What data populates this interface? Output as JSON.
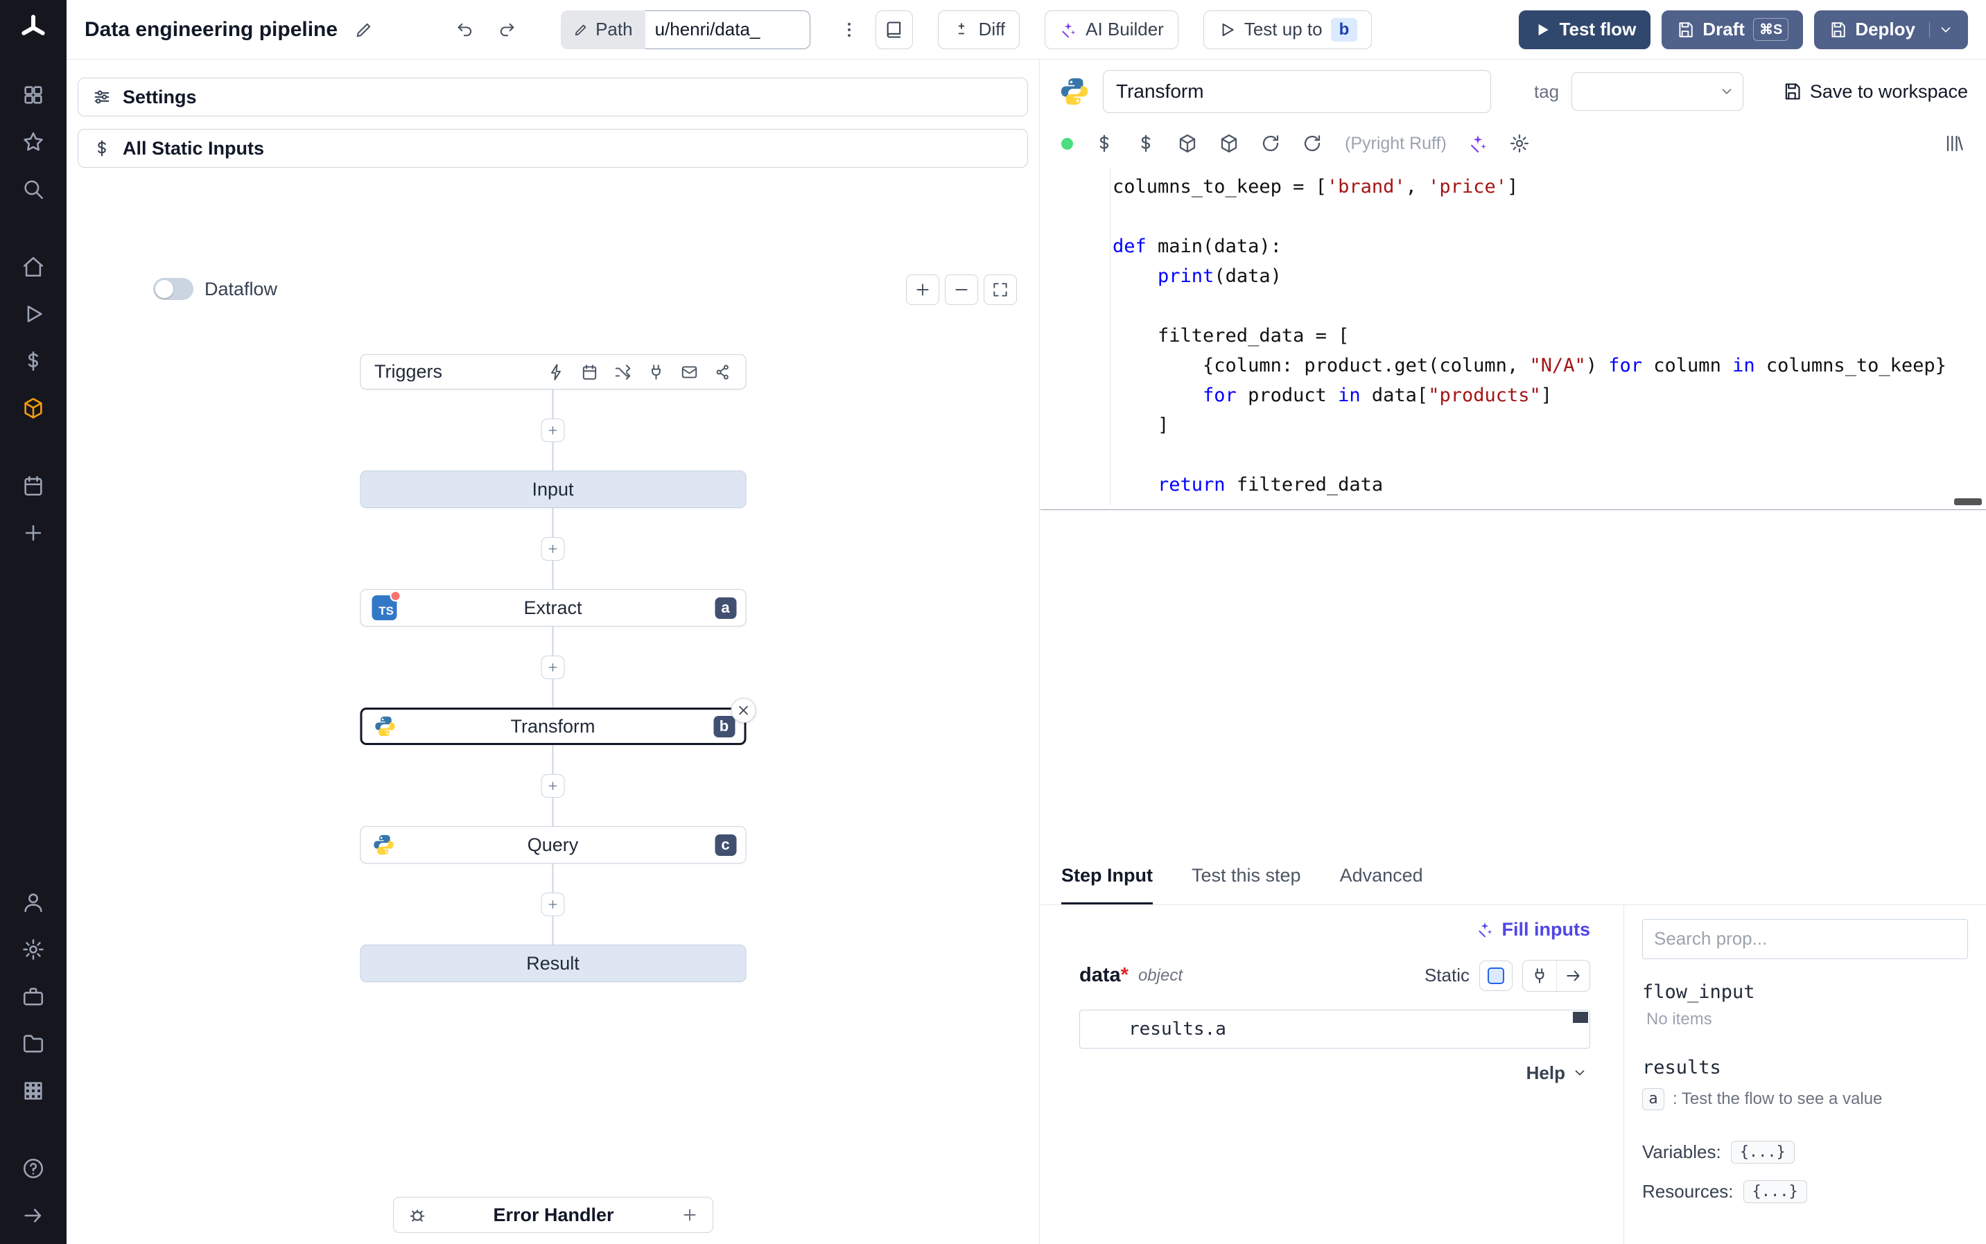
{
  "topbar": {
    "title": "Data engineering pipeline",
    "path_label": "Path",
    "path_value": "u/henri/data_",
    "diff_label": "Diff",
    "ai_builder_label": "AI Builder",
    "test_up_to_label": "Test up to",
    "test_up_to_badge": "b",
    "test_flow_label": "Test flow",
    "draft_label": "Draft",
    "draft_shortcut": "⌘S",
    "deploy_label": "Deploy"
  },
  "flow_panel": {
    "settings_label": "Settings",
    "static_inputs_label": "All Static Inputs",
    "dataflow_label": "Dataflow",
    "triggers_label": "Triggers",
    "nodes": {
      "input": "Input",
      "extract": {
        "label": "Extract",
        "badge": "a"
      },
      "transform": {
        "label": "Transform",
        "badge": "b"
      },
      "query": {
        "label": "Query",
        "badge": "c"
      },
      "result": "Result"
    },
    "error_handler_label": "Error Handler"
  },
  "editor": {
    "step_name": "Transform",
    "tag_label": "tag",
    "save_label": "Save to workspace",
    "lint_label": "(Pyright Ruff)"
  },
  "code": {
    "lines": [
      [
        [
          "columns_to_keep = [",
          ""
        ],
        [
          "'brand'",
          "s"
        ],
        [
          ", ",
          ""
        ],
        [
          "'price'",
          "s"
        ],
        [
          "]",
          ""
        ]
      ],
      [],
      [
        [
          "def",
          "k"
        ],
        [
          " main(data):",
          ""
        ]
      ],
      [
        [
          "    ",
          ""
        ],
        [
          "print",
          "k"
        ],
        [
          "(data)",
          ""
        ]
      ],
      [],
      [
        [
          "    filtered_data = [",
          ""
        ]
      ],
      [
        [
          "        {column: product.get(column, ",
          ""
        ],
        [
          "\"N/A\"",
          "s"
        ],
        [
          ") ",
          ""
        ],
        [
          "for",
          "k"
        ],
        [
          " column ",
          ""
        ],
        [
          "in",
          "k"
        ],
        [
          " columns_to_keep}",
          ""
        ]
      ],
      [
        [
          "        ",
          ""
        ],
        [
          "for",
          "k"
        ],
        [
          " product ",
          ""
        ],
        [
          "in",
          "k"
        ],
        [
          " data[",
          ""
        ],
        [
          "\"products\"",
          "s"
        ],
        [
          "]",
          ""
        ]
      ],
      [
        [
          "    ]",
          ""
        ]
      ],
      [],
      [
        [
          "    ",
          ""
        ],
        [
          "return",
          "k"
        ],
        [
          " filtered_data",
          ""
        ]
      ]
    ]
  },
  "step_panel": {
    "tabs": [
      "Step Input",
      "Test this step",
      "Advanced"
    ],
    "fill_inputs_label": "Fill inputs",
    "arg_name": "data",
    "arg_required": "*",
    "arg_type": "object",
    "static_label": "Static",
    "arg_value": "results.a",
    "help_label": "Help"
  },
  "props_panel": {
    "search_placeholder": "Search prop...",
    "flow_input_label": "flow_input",
    "flow_input_empty": "No items",
    "results_label": "results",
    "result_key": "a",
    "result_hint": ": Test the flow to see a value",
    "variables_label": "Variables:",
    "variables_value": "{...}",
    "resources_label": "Resources:",
    "resources_value": "{...}"
  }
}
